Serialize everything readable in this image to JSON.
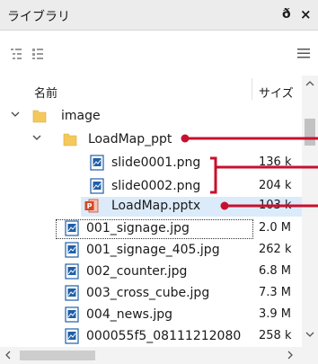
{
  "panel": {
    "title": "ライブラリ",
    "pin_glyph": "ð",
    "close_glyph": "×"
  },
  "toolbar": {
    "icons": [
      "tree-view-icon",
      "list-view-icon",
      "menu-icon"
    ]
  },
  "columns": {
    "name": "名前",
    "size": "サイズ"
  },
  "tree": [
    {
      "label": "image",
      "size": "",
      "icon": "folder-icon",
      "expanded": true
    },
    {
      "label": "LoadMap_ppt",
      "size": "",
      "icon": "folder-icon",
      "expanded": true
    },
    {
      "label": "slide0001.png",
      "size": "136 k",
      "icon": "image-file-icon"
    },
    {
      "label": "slide0002.png",
      "size": "204 k",
      "icon": "image-file-icon"
    },
    {
      "label": "LoadMap.pptx",
      "size": "103 k",
      "icon": "pptx-file-icon",
      "selected": true
    },
    {
      "label": "001_signage.jpg",
      "size": "2.0 M",
      "icon": "image-file-icon"
    },
    {
      "label": "001_signage_405.jpg",
      "size": "262 k",
      "icon": "image-file-icon"
    },
    {
      "label": "002_counter.jpg",
      "size": "6.8 M",
      "icon": "image-file-icon"
    },
    {
      "label": "003_cross_cube.jpg",
      "size": "7.3 M",
      "icon": "image-file-icon"
    },
    {
      "label": "004_news.jpg",
      "size": "3.9 M",
      "icon": "image-file-icon"
    },
    {
      "label": "000055f5_08111212080",
      "size": "258 k",
      "icon": "image-file-icon"
    }
  ],
  "colors": {
    "annotation": "#c8102e",
    "selection": "#dcebfa",
    "folder": "#f3c95c",
    "image_icon": "#1f5fa8",
    "pptx_icon": "#d24726"
  }
}
